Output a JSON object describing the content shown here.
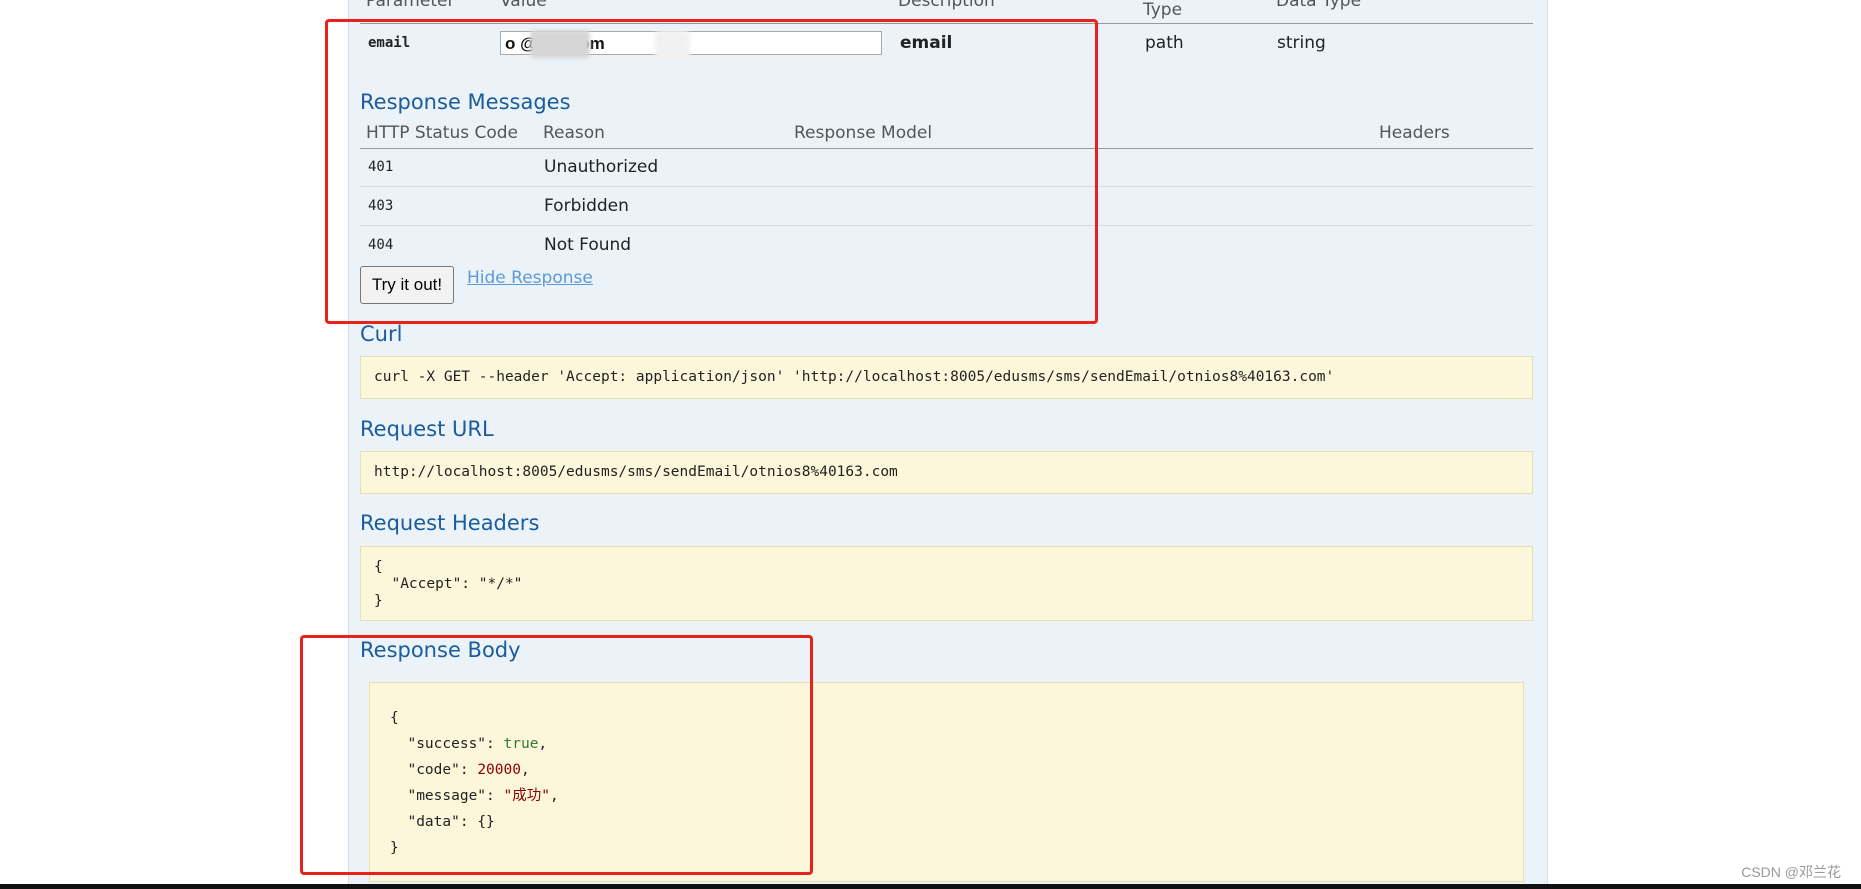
{
  "params_table": {
    "headers": {
      "parameter": "Parameter",
      "value": "Value",
      "description": "Description",
      "param_type": "Type",
      "data_type": "Data Type"
    },
    "row": {
      "name": "email",
      "value": "o        @163.com",
      "description": "email",
      "type": "path",
      "data_type": "string"
    }
  },
  "response_messages": {
    "title": "Response Messages",
    "headers": {
      "status": "HTTP Status Code",
      "reason": "Reason",
      "model": "Response Model",
      "headers": "Headers"
    },
    "rows": [
      {
        "code": "401",
        "reason": "Unauthorized"
      },
      {
        "code": "403",
        "reason": "Forbidden"
      },
      {
        "code": "404",
        "reason": "Not Found"
      }
    ]
  },
  "actions": {
    "try_label": "Try it out!",
    "hide_label": "Hide Response"
  },
  "curl": {
    "title": "Curl",
    "command": "curl -X GET --header 'Accept: application/json' 'http://localhost:8005/edusms/sms/sendEmail/otnios8%40163.com'"
  },
  "request_url": {
    "title": "Request URL",
    "url": "http://localhost:8005/edusms/sms/sendEmail/otnios8%40163.com"
  },
  "request_headers": {
    "title": "Request Headers",
    "line1": "{",
    "line2": "  \"Accept\": \"*/*\"",
    "line3": "}"
  },
  "response_body": {
    "title": "Response Body",
    "open": "{",
    "success_key": "  \"success\": ",
    "success_val": "true",
    "sep1": ",",
    "code_key": "  \"code\": ",
    "code_val": "20000",
    "sep2": ",",
    "message_key": "  \"message\": ",
    "message_val": "\"成功\"",
    "sep3": ",",
    "data_key": "  \"data\": ",
    "data_val": "{}",
    "close": "}"
  },
  "watermark": "CSDN @邓兰花",
  "colors": {
    "panel_bg": "#ebf3f9",
    "heading_blue": "#1a5c9c",
    "code_bg": "#fcf6db",
    "highlight_red": "#e8221b",
    "link_blue": "#5b9bd5"
  }
}
